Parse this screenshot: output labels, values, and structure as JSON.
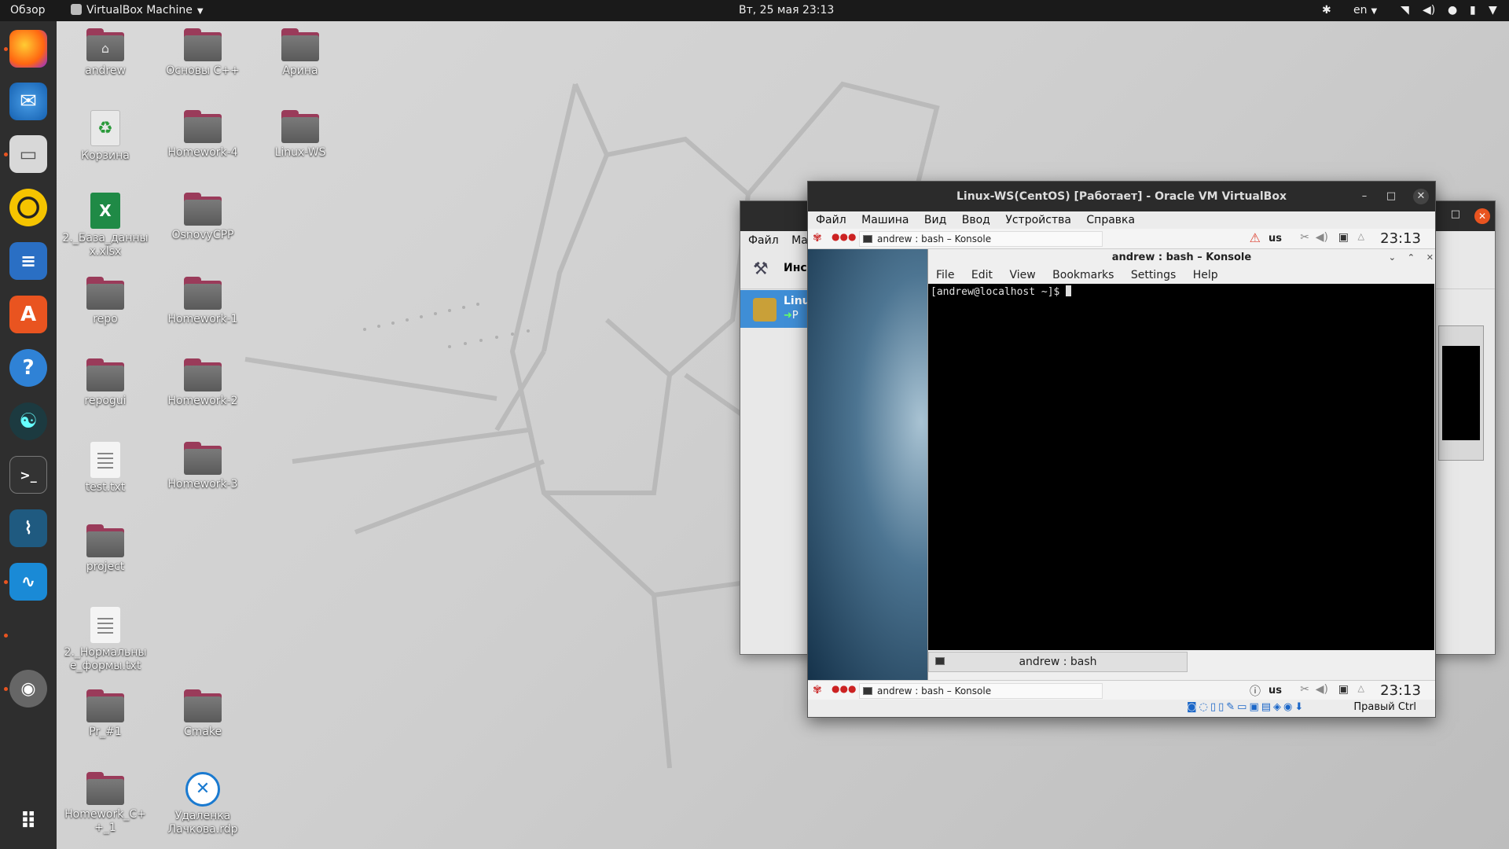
{
  "topbar": {
    "overview": "Обзор",
    "app_name": "VirtualBox Machine",
    "datetime": "Вт, 25 мая  23:13",
    "lang": "en"
  },
  "desktop_icons": [
    {
      "label": "andrew",
      "type": "home-folder"
    },
    {
      "label": "Основы С++",
      "type": "folder"
    },
    {
      "label": "Арина",
      "type": "folder"
    },
    {
      "label": "Корзина",
      "type": "trash"
    },
    {
      "label": "Homework-4",
      "type": "folder"
    },
    {
      "label": "Linux-WS",
      "type": "folder"
    },
    {
      "label": "2._База_данных.xlsx",
      "type": "spreadsheet"
    },
    {
      "label": "OsnovyCPP",
      "type": "folder"
    },
    {
      "label": "repo",
      "type": "folder"
    },
    {
      "label": "Homework-1",
      "type": "folder"
    },
    {
      "label": "repogui",
      "type": "folder"
    },
    {
      "label": "Homework-2",
      "type": "folder"
    },
    {
      "label": "test.txt",
      "type": "text"
    },
    {
      "label": "Homework-3",
      "type": "folder"
    },
    {
      "label": "project",
      "type": "folder"
    },
    {
      "label": "2._Нормальные_формы.txt",
      "type": "text"
    },
    {
      "label": "Pr_#1",
      "type": "folder"
    },
    {
      "label": "Cmake",
      "type": "folder"
    },
    {
      "label": "Homework_C++_1",
      "type": "folder"
    },
    {
      "label": "Удаленка Лачкова.rdp",
      "type": "rdp"
    }
  ],
  "vb_manager": {
    "menu_file": "Файл",
    "menu_machine": "Ма",
    "tools_label": "Инс",
    "vm_label": "Linu",
    "vm_state": "Р"
  },
  "vm_window": {
    "title": "Linux-WS(CentOS) [Работает] - Oracle VM VirtualBox",
    "menu": [
      "Файл",
      "Машина",
      "Вид",
      "Ввод",
      "Устройства",
      "Справка"
    ],
    "status_hostkey": "Правый Ctrl"
  },
  "guest": {
    "task_title": "andrew : bash – Konsole",
    "kbd_layout": "us",
    "clock": "23:13",
    "konsole": {
      "title": "andrew : bash – Konsole",
      "menu": [
        "File",
        "Edit",
        "View",
        "Bookmarks",
        "Settings",
        "Help"
      ],
      "prompt": "[andrew@localhost ~]$ ",
      "tab": "andrew : bash"
    }
  }
}
